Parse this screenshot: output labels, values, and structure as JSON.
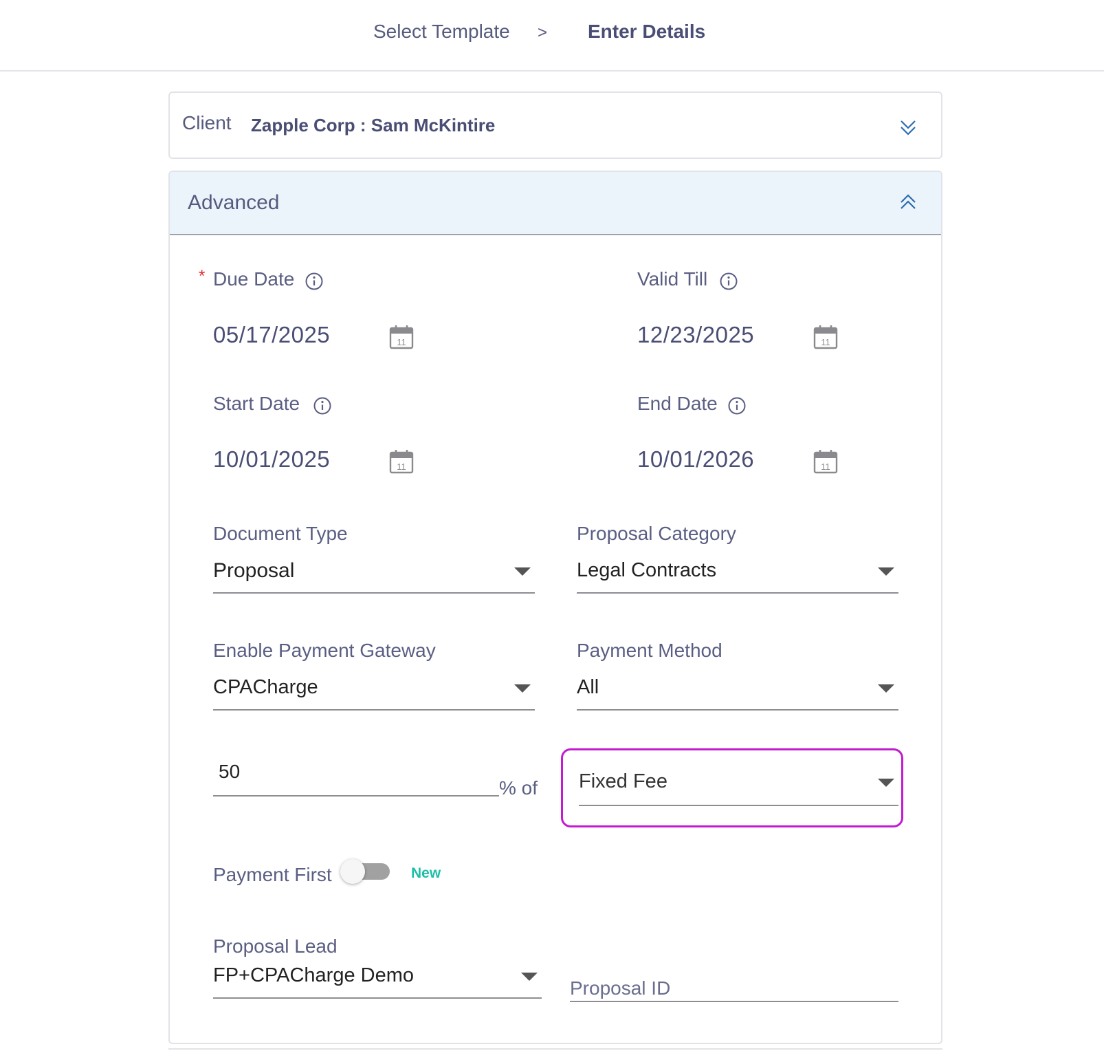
{
  "breadcrumb": {
    "step1": "Select Template",
    "separator": ">",
    "step2": "Enter Details"
  },
  "client": {
    "label": "Client",
    "value": "Zapple Corp : Sam McKintire",
    "toggle_icon": "double-chevron-down-icon"
  },
  "advanced": {
    "title": "Advanced",
    "toggle_icon": "double-chevron-up-icon",
    "due_date": {
      "required_mark": "*",
      "label": "Due Date",
      "value": "05/17/2025"
    },
    "valid_till": {
      "label": "Valid Till",
      "value": "12/23/2025"
    },
    "start_date": {
      "label": "Start Date",
      "value": "10/01/2025"
    },
    "end_date": {
      "label": "End Date",
      "value": "10/01/2026"
    },
    "calendar_day": "11",
    "document_type": {
      "label": "Document Type",
      "value": "Proposal"
    },
    "proposal_category": {
      "label": "Proposal Category",
      "value": "Legal Contracts"
    },
    "payment_gateway": {
      "label": "Enable Payment Gateway",
      "value": "CPACharge"
    },
    "payment_method": {
      "label": "Payment Method",
      "value": "All"
    },
    "percent": {
      "value": "50",
      "suffix": "% of"
    },
    "fee_basis": {
      "value": "Fixed Fee"
    },
    "payment_first": {
      "label": "Payment First",
      "enabled": false,
      "badge": "New"
    },
    "proposal_lead": {
      "label": "Proposal Lead",
      "value": "FP+CPACharge Demo"
    },
    "proposal_id": {
      "placeholder": "Proposal ID"
    }
  },
  "colors": {
    "accent": "#2b6cb0",
    "highlight": "#c21bd0",
    "new_badge": "#1bbfa8",
    "required": "#e02b2b",
    "advanced_header_bg": "#ebf3fb"
  }
}
